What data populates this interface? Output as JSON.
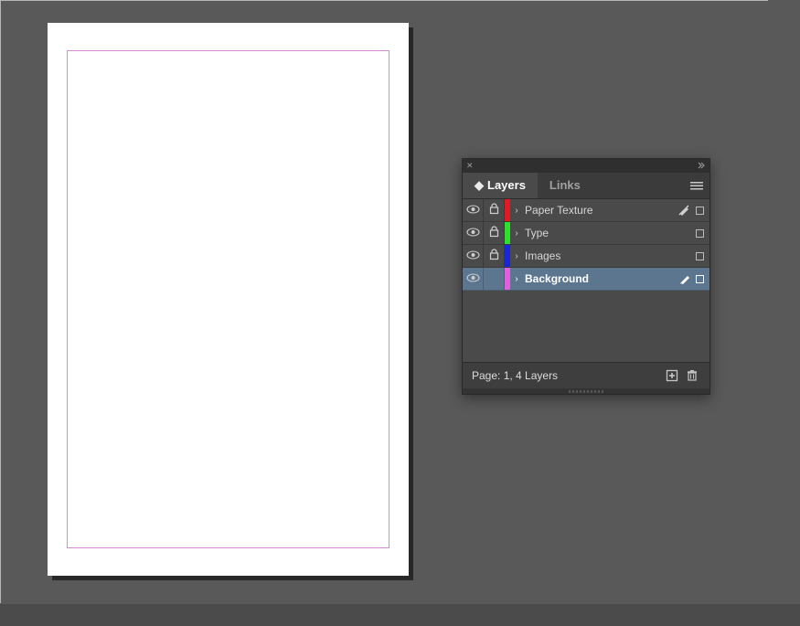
{
  "panel": {
    "tabs": [
      {
        "label": "Layers",
        "active": true
      },
      {
        "label": "Links",
        "active": false
      }
    ],
    "layers": [
      {
        "name": "Paper Texture",
        "color": "#e01b24",
        "visible": true,
        "locked": true,
        "selected": false,
        "crossed_pencil": true,
        "pen": false
      },
      {
        "name": "Type",
        "color": "#2de02d",
        "visible": true,
        "locked": true,
        "selected": false,
        "crossed_pencil": false,
        "pen": false
      },
      {
        "name": "Images",
        "color": "#1828d8",
        "visible": true,
        "locked": true,
        "selected": false,
        "crossed_pencil": false,
        "pen": false
      },
      {
        "name": "Background",
        "color": "#e060e0",
        "visible": true,
        "locked": false,
        "selected": true,
        "crossed_pencil": false,
        "pen": true
      }
    ],
    "footer_text": "Page: 1, 4 Layers"
  }
}
